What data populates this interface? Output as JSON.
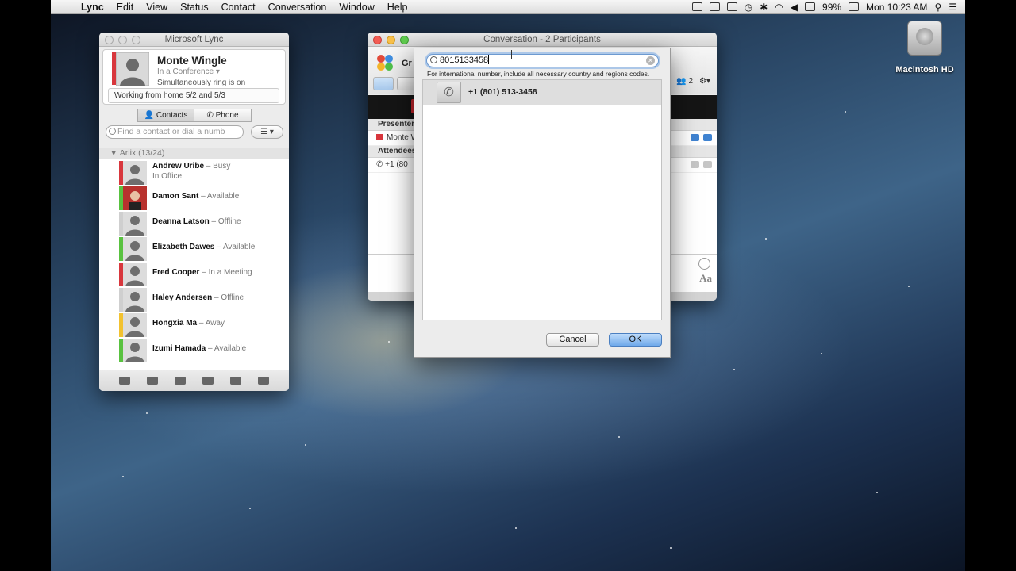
{
  "menubar": {
    "app": "Lync",
    "items": [
      "Edit",
      "View",
      "Status",
      "Contact",
      "Conversation",
      "Window",
      "Help"
    ],
    "battery": "99%",
    "clock": "Mon 10:23 AM"
  },
  "desktop": {
    "drive_label": "Macintosh HD"
  },
  "lync": {
    "title": "Microsoft Lync",
    "user_name": "Monte Wingle",
    "user_status": "In a Conference ▾",
    "ring_note": "Simultaneously ring is on",
    "personal_note": "Working from home 5/2 and 5/3",
    "tabs": [
      "Contacts",
      "Phone"
    ],
    "search_placeholder": "Find a contact or dial a numb",
    "view_button": "☰ ▾",
    "group_name": "Ariix",
    "group_count": "(13/24)",
    "contacts": [
      {
        "name": "Andrew Uribe",
        "status": "Busy",
        "sub": "In Office",
        "color": "#d8373d"
      },
      {
        "name": "Damon Sant",
        "status": "Available",
        "sub": "",
        "color": "#59c240"
      },
      {
        "name": "Deanna Latson",
        "status": "Offline",
        "sub": "",
        "color": "#cfcfcf"
      },
      {
        "name": "Elizabeth Dawes",
        "status": "Available",
        "sub": "",
        "color": "#59c240"
      },
      {
        "name": "Fred Cooper",
        "status": "In a Meeting",
        "sub": "",
        "color": "#d8373d"
      },
      {
        "name": "Haley Andersen",
        "status": "Offline",
        "sub": "",
        "color": "#cfcfcf"
      },
      {
        "name": "Hongxia Ma",
        "status": "Away",
        "sub": "",
        "color": "#f2c230"
      },
      {
        "name": "Izumi Hamada",
        "status": "Available",
        "sub": "",
        "color": "#59c240"
      }
    ]
  },
  "conversation": {
    "title": "Conversation - 2 Participants",
    "group_abbrev": "Gr",
    "participants_count": "2",
    "presenters_label": "Presenters",
    "presenter_name": "Monte W",
    "attendees_label": "Attendees",
    "attendee_number": "+1 (80"
  },
  "dialog": {
    "input_value": "8015133458",
    "hint": "For international number, include all necessary country and regions codes.",
    "result_number": "+1 (801) 513-3458",
    "cancel_label": "Cancel",
    "ok_label": "OK"
  }
}
